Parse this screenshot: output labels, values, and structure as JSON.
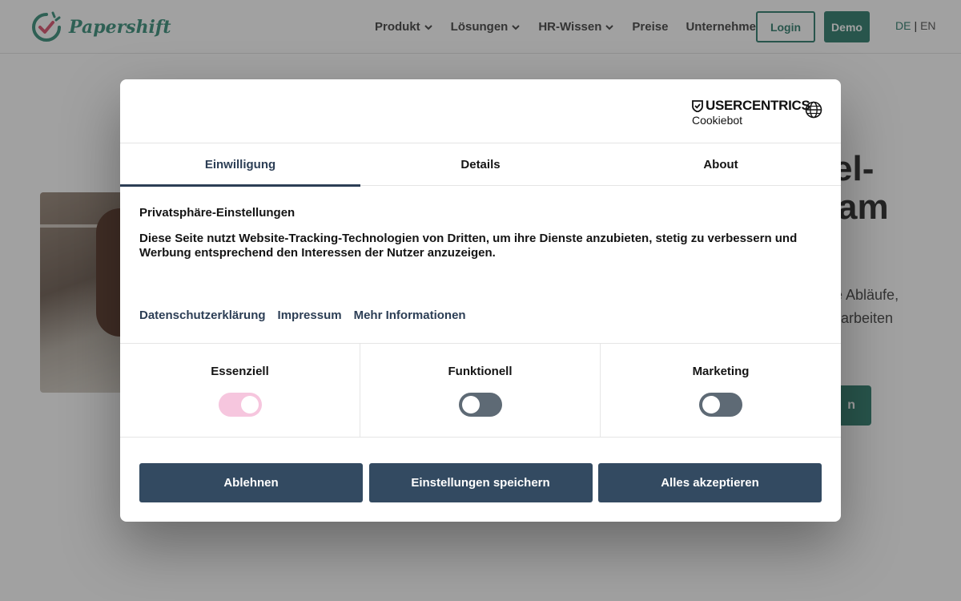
{
  "site": {
    "logo_text": "Papershift",
    "nav": [
      {
        "label": "Produkt",
        "has_dropdown": true
      },
      {
        "label": "Lösungen",
        "has_dropdown": true
      },
      {
        "label": "HR-Wissen",
        "has_dropdown": true
      },
      {
        "label": "Preise",
        "has_dropdown": false
      },
      {
        "label": "Unternehmen",
        "has_dropdown": true
      }
    ],
    "login_label": "Login",
    "demo_label": "Demo",
    "lang_de": "DE",
    "lang_sep": "|",
    "lang_en": "EN",
    "hero_fragments": {
      "title_1": "el-",
      "title_2": "am",
      "text_1": "e Abläufe,",
      "text_2": "arbeiten",
      "cta": "n"
    },
    "brand_color": "#2f7d6d"
  },
  "consent": {
    "provider_brand": "USERCENTRICS",
    "provider_sub": "Cookiebot",
    "tabs": [
      {
        "label": "Einwilligung",
        "active": true
      },
      {
        "label": "Details",
        "active": false
      },
      {
        "label": "About",
        "active": false
      }
    ],
    "heading": "Privatsphäre-Einstellungen",
    "description": "Diese Seite nutzt Website-Tracking-Technologien von Dritten, um ihre Dienste anzubieten, stetig zu verbessern und Werbung entsprechend den Interessen der Nutzer anzuzeigen.",
    "links": [
      "Datenschutzerklärung",
      "Impressum",
      "Mehr Informationen"
    ],
    "categories": [
      {
        "label": "Essenziell",
        "enabled": true
      },
      {
        "label": "Funktionell",
        "enabled": false
      },
      {
        "label": "Marketing",
        "enabled": false
      }
    ],
    "buttons": {
      "reject": "Ablehnen",
      "save": "Einstellungen speichern",
      "accept_all": "Alles akzeptieren"
    },
    "accent_color": "#334a61",
    "toggle_on_color": "#f6c6de",
    "toggle_off_color": "#5e6a75"
  }
}
